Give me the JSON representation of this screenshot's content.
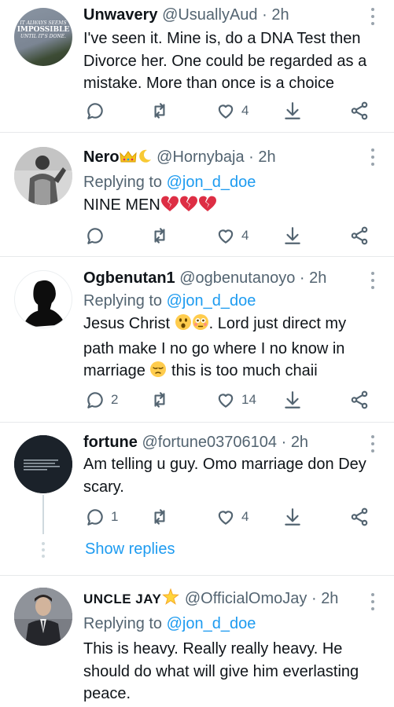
{
  "tweets": [
    {
      "name": "Unwavery",
      "handle": "@UsuallyAud",
      "time": "2h",
      "replying_prefix": "",
      "replying_handle": "",
      "text": "I've seen it. Mine is, do a DNA Test then Divorce her. One could be regarded as a mistake. More than once is a choice",
      "avatar_text": [
        "IT ALWAYS SEEMS",
        "IMPOSSIBLE",
        "UNTIL IT'S DONE."
      ],
      "replies": "",
      "retweets": "",
      "likes": "4"
    },
    {
      "name": "Nero",
      "handle": "@Hornybaja",
      "time": "2h",
      "replying_prefix": "Replying to",
      "replying_handle": "@jon_d_doe",
      "text": "NINE MEN",
      "replies": "",
      "retweets": "",
      "likes": "4"
    },
    {
      "name": "Ogbenutan1",
      "handle": "@ogbenutanoyo",
      "time": "2h",
      "replying_prefix": "Replying to",
      "replying_handle": "@jon_d_doe",
      "text_parts": [
        "Jesus Christ ",
        ". Lord just direct my path make I no go where I no know in marriage ",
        " this is too much chaii"
      ],
      "replies": "2",
      "retweets": "",
      "likes": "14"
    },
    {
      "name": "fortune",
      "handle": "@fortune03706104",
      "time": "2h",
      "replying_prefix": "",
      "replying_handle": "",
      "text": "Am telling u guy. Omo marriage don Dey scary.",
      "replies": "1",
      "retweets": "",
      "likes": "4"
    },
    {
      "name": "UNCLE JAY",
      "handle": "@OfficialOmoJay",
      "time": "2h",
      "replying_prefix": "Replying to",
      "replying_handle": "@jon_d_doe",
      "text": "This is heavy. Really really heavy. He should do what will give him everlasting peace."
    }
  ],
  "show_replies_label": "Show replies",
  "separator": "·",
  "colors": {
    "accent": "#1d9bf0",
    "muted": "#536471",
    "heart": "#e0245e",
    "divider": "#e7e9eb"
  },
  "icons": [
    "reply-icon",
    "retweet-icon",
    "like-icon",
    "download-icon",
    "share-icon",
    "more-icon"
  ]
}
